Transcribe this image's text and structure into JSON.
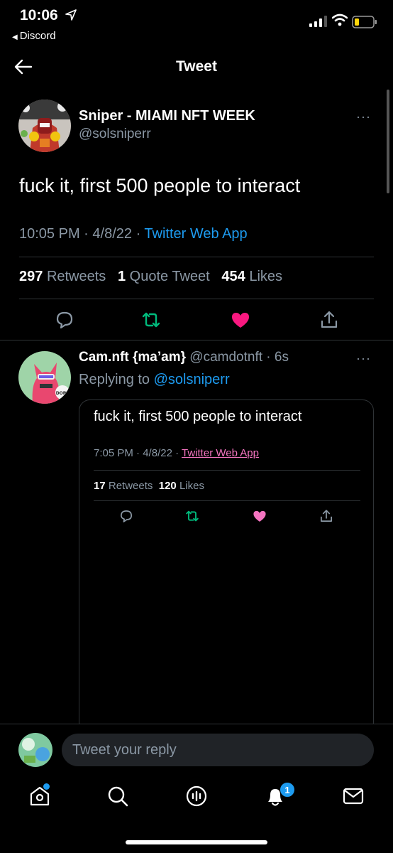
{
  "status_bar": {
    "time": "10:06",
    "back_app": "Discord"
  },
  "header": {
    "title": "Tweet"
  },
  "main_tweet": {
    "display_name": "Sniper - MIAMI NFT WEEK",
    "handle": "@solsniperr",
    "text": "fuck it, first 500 people to interact",
    "time": "10:05 PM",
    "date": "4/8/22",
    "source": "Twitter Web App",
    "retweets_count": "297",
    "retweets_label": "Retweets",
    "quote_count": "1",
    "quote_label": "Quote Tweet",
    "likes_count": "454",
    "likes_label": "Likes",
    "more": "···"
  },
  "reply_tweet": {
    "display_name": "Cam.nft {ma’am}",
    "handle": "@camdotnft",
    "age": "6s",
    "replying_label": "Replying to",
    "replying_to": "@solsniperr",
    "more": "···",
    "quoted": {
      "text": "fuck it, first 500 people to interact",
      "time": "7:05 PM",
      "date": "4/8/22",
      "source": "Twitter Web App",
      "retweets_count": "17",
      "retweets_label": "Retweets",
      "likes_count": "120",
      "likes_label": "Likes"
    },
    "avatar_text": "DOPE"
  },
  "reply_bar": {
    "placeholder": "Tweet your reply"
  },
  "bottom_nav": {
    "items": [
      "home-icon",
      "search-icon",
      "spaces-icon",
      "notifications-icon",
      "messages-icon"
    ],
    "notification_badge": "1"
  },
  "colors": {
    "accent": "#1d9bf0",
    "like": "#f91880",
    "retweet": "#00ba7c",
    "muted": "#8b98a5",
    "divider": "#2f3336"
  }
}
